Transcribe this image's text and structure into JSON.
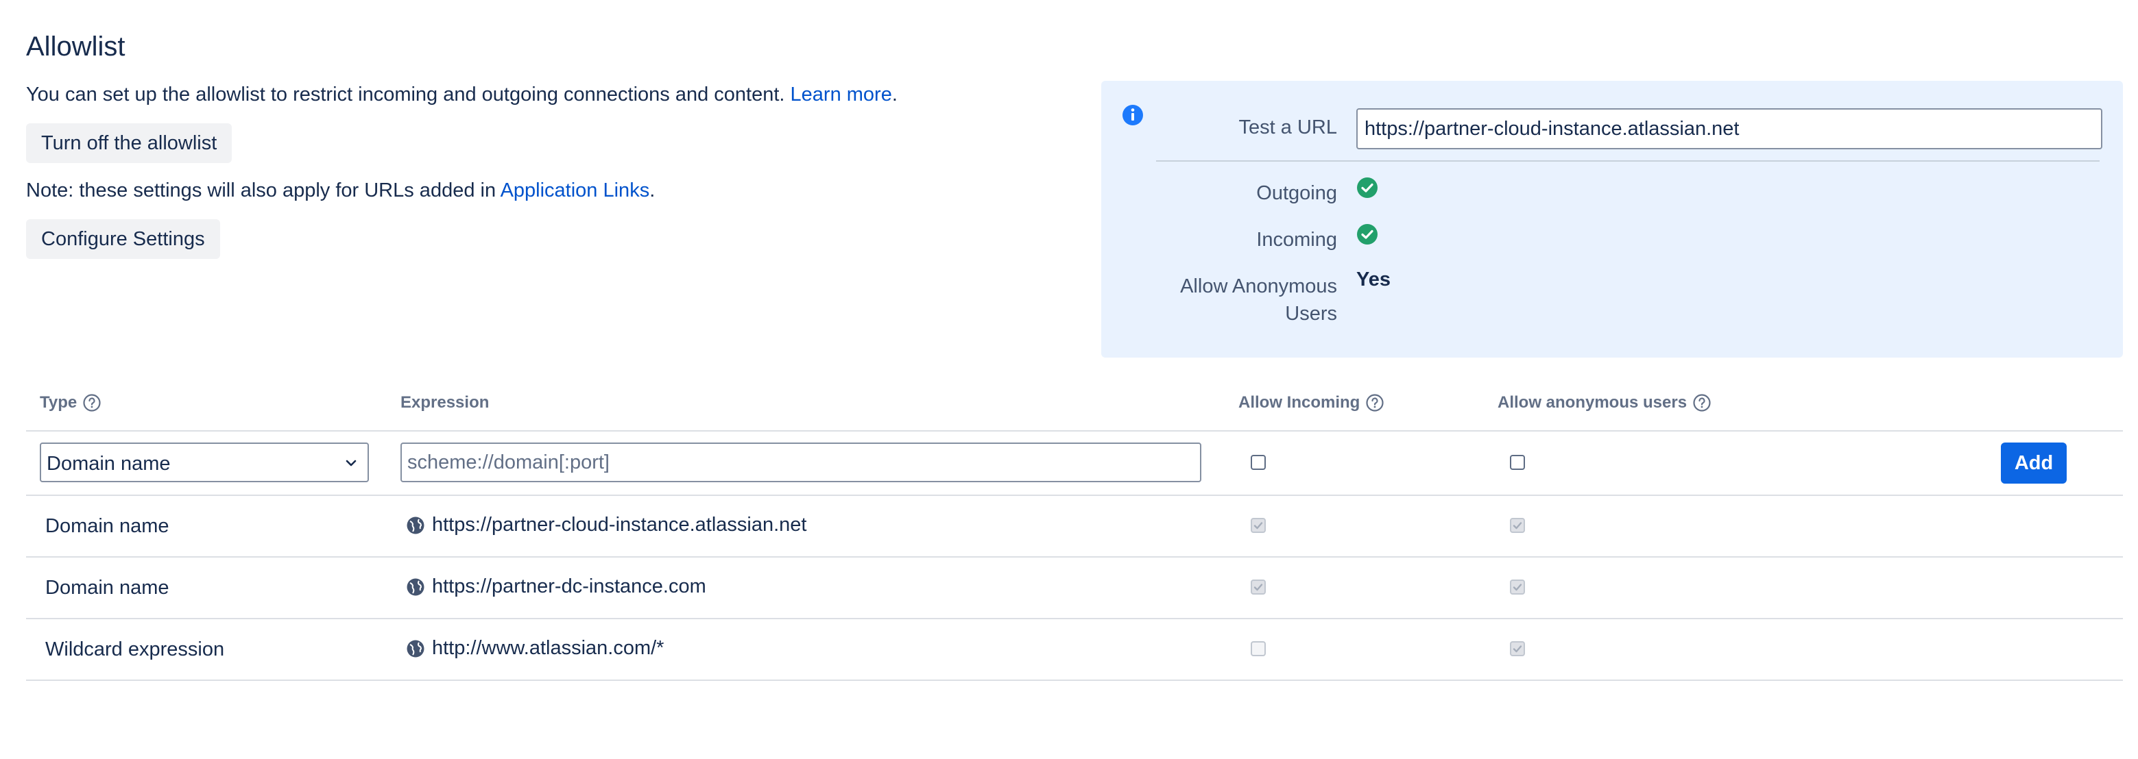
{
  "page": {
    "title": "Allowlist",
    "description": "You can set up the allowlist to restrict incoming and outgoing connections and content.",
    "learn_more": "Learn more",
    "period": ".",
    "turn_off_button": "Turn off the allowlist",
    "note_prefix": "Note: these settings will also apply for URLs added in",
    "note_link": "Application Links",
    "note_suffix": ".",
    "configure_button": "Configure Settings"
  },
  "test_panel": {
    "test_url_label": "Test a URL",
    "test_url_value": "https://partner-cloud-instance.atlassian.net",
    "outgoing_label": "Outgoing",
    "incoming_label": "Incoming",
    "anonymous_label": "Allow Anonymous Users",
    "anonymous_value": "Yes",
    "outgoing_status": "allowed",
    "incoming_status": "allowed",
    "success_color": "#22a06b"
  },
  "table": {
    "headers": {
      "type": "Type",
      "expression": "Expression",
      "allow_incoming": "Allow Incoming",
      "allow_anonymous": "Allow anonymous users"
    },
    "new_row": {
      "type_selected": "Domain name",
      "expression_placeholder": "scheme://domain[:port]",
      "add_button": "Add"
    },
    "rows": [
      {
        "type": "Domain name",
        "expression": "https://partner-cloud-instance.atlassian.net",
        "allow_incoming": true,
        "allow_anonymous": true
      },
      {
        "type": "Domain name",
        "expression": "https://partner-dc-instance.com",
        "allow_incoming": true,
        "allow_anonymous": true
      },
      {
        "type": "Wildcard expression",
        "expression": "http://www.atlassian.com/*",
        "allow_incoming": false,
        "allow_anonymous": true
      }
    ]
  },
  "colors": {
    "primary": "#0c66e4",
    "link": "#0052cc",
    "panel_bg": "#e9f2fe"
  }
}
